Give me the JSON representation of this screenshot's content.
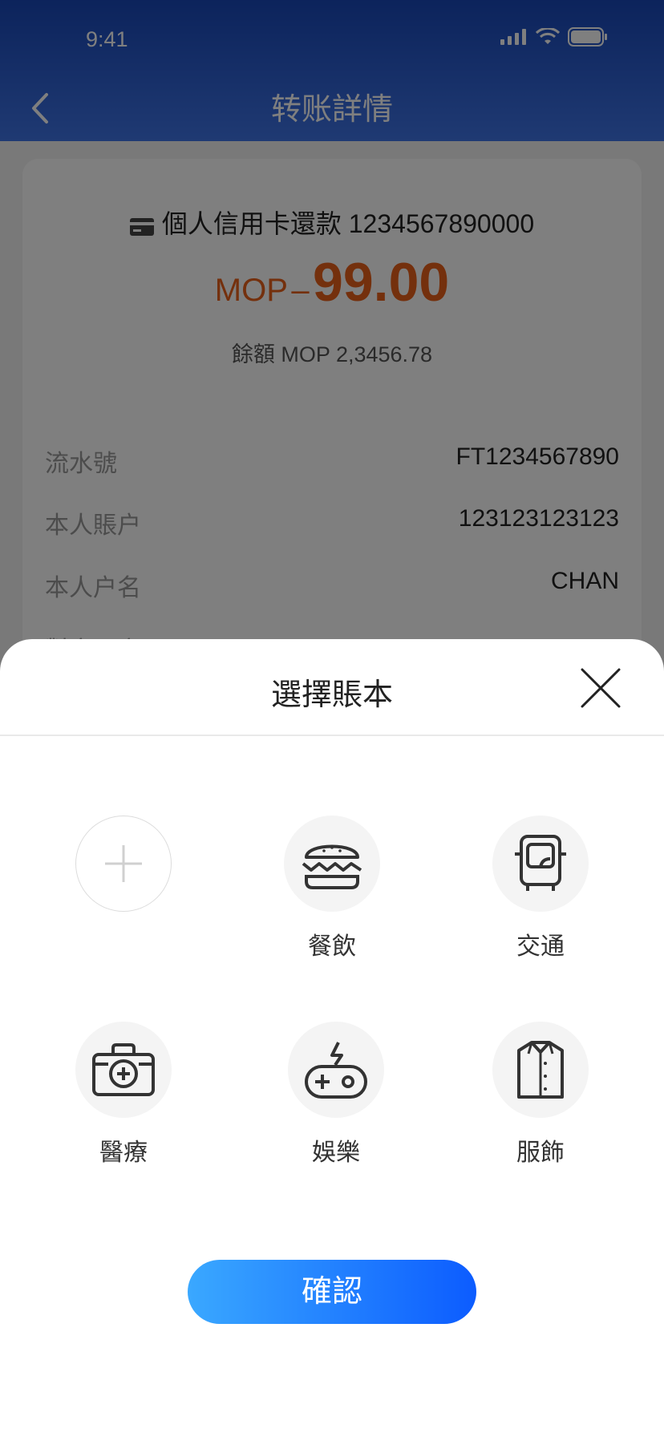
{
  "status_bar": {
    "time": "9:41"
  },
  "nav": {
    "title": "转账詳情"
  },
  "transaction": {
    "account_line": "個人信用卡還款 1234567890000",
    "currency": "MOP",
    "sign": "–",
    "amount": "99.00",
    "balance": "餘額 MOP 2,3456.78",
    "details": [
      {
        "label": "流水號",
        "value": "FT1234567890"
      },
      {
        "label": "本人賬户",
        "value": "123123123123"
      },
      {
        "label": "本人户名",
        "value": "CHAN"
      },
      {
        "label": "對方賬户",
        "value": ""
      }
    ]
  },
  "sheet": {
    "title": "選擇賬本",
    "categories": [
      {
        "label": "",
        "icon": "add-icon"
      },
      {
        "label": "餐飲",
        "icon": "burger-icon"
      },
      {
        "label": "交通",
        "icon": "bus-icon"
      },
      {
        "label": "醫療",
        "icon": "medical-kit-icon"
      },
      {
        "label": "娛樂",
        "icon": "gamepad-icon"
      },
      {
        "label": "服飾",
        "icon": "shirt-icon"
      }
    ],
    "confirm_label": "確認"
  },
  "colors": {
    "accent": "#e8601b",
    "header": "#1847b8",
    "button_start": "#3aa8ff",
    "button_end": "#0c5cff"
  }
}
